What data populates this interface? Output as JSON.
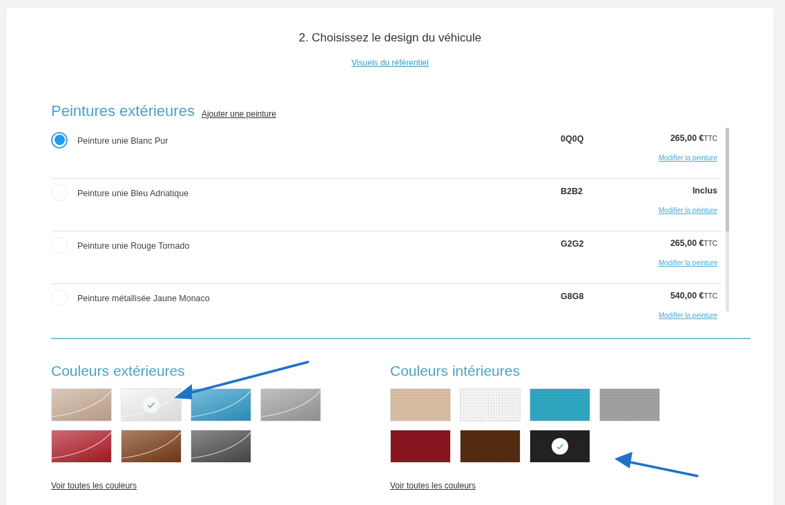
{
  "header": {
    "title": "2. Choisissez le design du véhicule",
    "link": "Visuels du référentiel"
  },
  "paints": {
    "title": "Peintures extérieures",
    "add_link": "Ajouter une peinture",
    "items": [
      {
        "name": "Peinture unie Blanc Pur",
        "code": "0Q0Q",
        "price": "265,00 €",
        "suffix": "TTC",
        "edit_link": "Modifier la peinture",
        "selected": true
      },
      {
        "name": "Peinture unie Bleu Adriatique",
        "code": "B2B2",
        "price": "Inclus",
        "edit_link": "Modifier la peinture",
        "selected": false
      },
      {
        "name": "Peinture unie Rouge Tornado",
        "code": "G2G2",
        "price": "265,00 €",
        "suffix": "TTC",
        "edit_link": "Modifier la peinture",
        "selected": false
      },
      {
        "name": "Peinture métallisée Jaune Monaco",
        "code": "G8G8",
        "price": "540,00 €",
        "suffix": "TTC",
        "edit_link": "Modifier la peinture",
        "selected": false
      }
    ]
  },
  "color_sections": [
    {
      "title": "Couleurs extérieures",
      "kind": "glossy",
      "link": "Voir toutes les couleurs",
      "swatches": [
        {
          "color": "#c9ab95",
          "selected": false
        },
        {
          "color": "#f2f2f2",
          "selected": true
        },
        {
          "color": "#2e9ac9",
          "selected": false
        },
        {
          "color": "#9e9e9e",
          "selected": false
        },
        {
          "color": "#b01a25",
          "selected": false
        },
        {
          "color": "#7a3a14",
          "selected": false
        },
        {
          "color": "#4a4a4a",
          "selected": false
        }
      ]
    },
    {
      "title": "Couleurs intérieures",
      "kind": "fabric",
      "link": "Voir toutes les couleurs",
      "swatches": [
        {
          "color": "#dcc0a4",
          "selected": false
        },
        {
          "color": "#f7f7f7",
          "selected": false
        },
        {
          "color": "#30a9c4",
          "selected": false
        },
        {
          "color": "#a3a3a3",
          "selected": false
        },
        {
          "color": "#8c1520",
          "selected": false
        },
        {
          "color": "#562c10",
          "selected": false
        },
        {
          "color": "#222222",
          "selected": true
        }
      ]
    }
  ]
}
